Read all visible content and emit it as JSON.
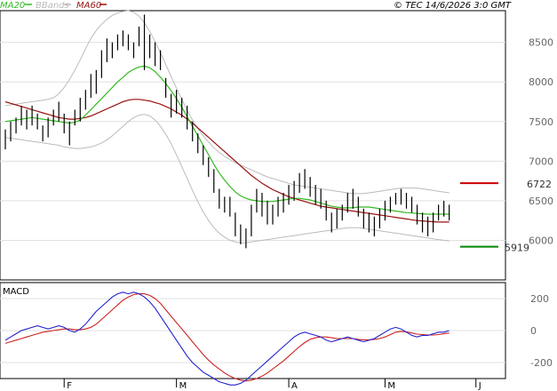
{
  "legend": {
    "ma20_label": "MA20",
    "bbands_label": "BBands",
    "ma60_label": "MA60"
  },
  "copyright": "© TEC 14/6/2026 3:0 GMT",
  "indicator_label": "MACD",
  "colors": {
    "ma20": "#33bb22",
    "bbands": "#bbbbbb",
    "ma60": "#991111",
    "macd": "#2222cc",
    "signal": "#cc2222",
    "price_bar": "#000000",
    "resistance": "#cc0000",
    "support": "#008800",
    "grid": "#e0e0e0"
  },
  "chart_data": {
    "type": "line",
    "price_panel": {
      "y_ticks": [
        6000,
        6500,
        7000,
        7500,
        8000,
        8500
      ],
      "y_tick_labels": [
        "6000",
        "6500",
        "7000",
        "7500",
        "8000",
        "8500"
      ],
      "ylim": [
        5500,
        8900
      ],
      "resistance": {
        "value": 6722,
        "label": "6722"
      },
      "support": {
        "value": 5919,
        "label": "5919"
      },
      "months": [
        {
          "label": "F",
          "index": 11
        },
        {
          "label": "M",
          "index": 32
        },
        {
          "label": "A",
          "index": 53
        },
        {
          "label": "M",
          "index": 71
        },
        {
          "label": "J",
          "index": 88
        }
      ],
      "bars": [
        [
          7400,
          7150
        ],
        [
          7500,
          7250
        ],
        [
          7550,
          7350
        ],
        [
          7700,
          7450
        ],
        [
          7650,
          7400
        ],
        [
          7700,
          7450
        ],
        [
          7600,
          7400
        ],
        [
          7450,
          7250
        ],
        [
          7550,
          7300
        ],
        [
          7650,
          7450
        ],
        [
          7750,
          7500
        ],
        [
          7600,
          7350
        ],
        [
          7500,
          7200
        ],
        [
          7650,
          7450
        ],
        [
          7800,
          7500
        ],
        [
          7900,
          7650
        ],
        [
          8100,
          7800
        ],
        [
          8150,
          7850
        ],
        [
          8400,
          8050
        ],
        [
          8550,
          8250
        ],
        [
          8500,
          8300
        ],
        [
          8600,
          8400
        ],
        [
          8650,
          8450
        ],
        [
          8600,
          8400
        ],
        [
          8500,
          8300
        ],
        [
          8700,
          8450
        ],
        [
          8850,
          8150
        ],
        [
          8600,
          8300
        ],
        [
          8500,
          8200
        ],
        [
          8400,
          8150
        ],
        [
          8050,
          7800
        ],
        [
          7850,
          7550
        ],
        [
          7900,
          7600
        ],
        [
          7800,
          7550
        ],
        [
          7700,
          7400
        ],
        [
          7500,
          7250
        ],
        [
          7350,
          7100
        ],
        [
          7200,
          6950
        ],
        [
          7050,
          6800
        ],
        [
          6900,
          6600
        ],
        [
          6650,
          6400
        ],
        [
          6550,
          6350
        ],
        [
          6550,
          6300
        ],
        [
          6350,
          6050
        ],
        [
          6200,
          5950
        ],
        [
          6150,
          5900
        ],
        [
          6450,
          6050
        ],
        [
          6650,
          6350
        ],
        [
          6600,
          6300
        ],
        [
          6500,
          6200
        ],
        [
          6450,
          6200
        ],
        [
          6550,
          6300
        ],
        [
          6600,
          6350
        ],
        [
          6700,
          6450
        ],
        [
          6750,
          6500
        ],
        [
          6850,
          6600
        ],
        [
          6900,
          6650
        ],
        [
          6800,
          6550
        ],
        [
          6700,
          6450
        ],
        [
          6650,
          6400
        ],
        [
          6500,
          6250
        ],
        [
          6350,
          6100
        ],
        [
          6400,
          6150
        ],
        [
          6450,
          6250
        ],
        [
          6600,
          6350
        ],
        [
          6650,
          6400
        ],
        [
          6550,
          6300
        ],
        [
          6400,
          6150
        ],
        [
          6350,
          6100
        ],
        [
          6300,
          6050
        ],
        [
          6400,
          6150
        ],
        [
          6500,
          6250
        ],
        [
          6550,
          6350
        ],
        [
          6600,
          6450
        ],
        [
          6650,
          6450
        ],
        [
          6600,
          6400
        ],
        [
          6550,
          6350
        ],
        [
          6450,
          6200
        ],
        [
          6350,
          6100
        ],
        [
          6300,
          6050
        ],
        [
          6350,
          6100
        ],
        [
          6450,
          6250
        ],
        [
          6500,
          6300
        ],
        [
          6450,
          6250
        ]
      ],
      "ma20": [
        7500,
        7510,
        7520,
        7530,
        7540,
        7550,
        7540,
        7530,
        7520,
        7510,
        7500,
        7490,
        7480,
        7490,
        7520,
        7580,
        7650,
        7720,
        7790,
        7860,
        7930,
        8000,
        8060,
        8120,
        8160,
        8190,
        8200,
        8180,
        8130,
        8060,
        7980,
        7890,
        7790,
        7680,
        7560,
        7440,
        7320,
        7200,
        7080,
        6960,
        6850,
        6760,
        6680,
        6610,
        6560,
        6530,
        6510,
        6500,
        6490,
        6490,
        6490,
        6500,
        6510,
        6520,
        6530,
        6530,
        6520,
        6510,
        6490,
        6470,
        6450,
        6430,
        6420,
        6410,
        6410,
        6410,
        6420,
        6420,
        6420,
        6410,
        6400,
        6390,
        6380,
        6370,
        6360,
        6350,
        6345,
        6340,
        6335,
        6330,
        6330,
        6330,
        6330,
        6330
      ],
      "ma60": [
        7750,
        7730,
        7710,
        7690,
        7670,
        7650,
        7630,
        7610,
        7590,
        7570,
        7550,
        7540,
        7530,
        7530,
        7540,
        7550,
        7570,
        7600,
        7630,
        7660,
        7690,
        7720,
        7750,
        7770,
        7780,
        7780,
        7770,
        7760,
        7740,
        7720,
        7690,
        7660,
        7620,
        7580,
        7530,
        7480,
        7420,
        7360,
        7300,
        7240,
        7180,
        7120,
        7060,
        7000,
        6940,
        6880,
        6820,
        6770,
        6720,
        6680,
        6640,
        6610,
        6580,
        6550,
        6530,
        6510,
        6490,
        6470,
        6450,
        6430,
        6420,
        6410,
        6400,
        6390,
        6380,
        6370,
        6360,
        6350,
        6340,
        6330,
        6320,
        6310,
        6300,
        6290,
        6280,
        6270,
        6260,
        6250,
        6245,
        6240,
        6235,
        6230,
        6230,
        6230
      ],
      "bb_upper": [
        7700,
        7710,
        7720,
        7730,
        7740,
        7750,
        7760,
        7770,
        7780,
        7800,
        7850,
        7930,
        8030,
        8150,
        8280,
        8420,
        8550,
        8650,
        8730,
        8790,
        8840,
        8870,
        8890,
        8900,
        8880,
        8830,
        8750,
        8640,
        8510,
        8370,
        8220,
        8070,
        7920,
        7780,
        7640,
        7520,
        7410,
        7320,
        7240,
        7170,
        7110,
        7060,
        7020,
        6980,
        6950,
        6920,
        6890,
        6860,
        6830,
        6800,
        6780,
        6760,
        6740,
        6720,
        6700,
        6690,
        6680,
        6670,
        6660,
        6650,
        6640,
        6630,
        6620,
        6610,
        6600,
        6590,
        6590,
        6590,
        6600,
        6610,
        6620,
        6630,
        6640,
        6650,
        6660,
        6660,
        6660,
        6660,
        6650,
        6640,
        6630,
        6620,
        6610,
        6600
      ],
      "bb_lower": [
        7300,
        7290,
        7280,
        7270,
        7260,
        7250,
        7240,
        7230,
        7220,
        7210,
        7200,
        7180,
        7170,
        7160,
        7160,
        7170,
        7180,
        7200,
        7230,
        7270,
        7320,
        7380,
        7440,
        7500,
        7550,
        7580,
        7590,
        7570,
        7520,
        7440,
        7340,
        7220,
        7080,
        6930,
        6780,
        6630,
        6490,
        6360,
        6250,
        6160,
        6090,
        6040,
        6000,
        5980,
        5970,
        5970,
        5980,
        5990,
        6000,
        6010,
        6020,
        6030,
        6040,
        6050,
        6060,
        6070,
        6080,
        6090,
        6100,
        6110,
        6120,
        6130,
        6140,
        6150,
        6160,
        6160,
        6160,
        6150,
        6140,
        6130,
        6120,
        6110,
        6100,
        6090,
        6080,
        6070,
        6060,
        6050,
        6040,
        6030,
        6020,
        6010,
        6000,
        5990
      ]
    },
    "macd_panel": {
      "y_ticks": [
        -200,
        0,
        200
      ],
      "y_tick_labels": [
        "-200",
        "0",
        "200"
      ],
      "ylim": [
        -300,
        300
      ],
      "macd": [
        -60,
        -40,
        -20,
        0,
        10,
        20,
        30,
        20,
        10,
        20,
        30,
        20,
        0,
        -10,
        10,
        40,
        80,
        120,
        150,
        180,
        210,
        230,
        240,
        230,
        240,
        230,
        210,
        180,
        140,
        90,
        40,
        -10,
        -60,
        -110,
        -160,
        -200,
        -230,
        -260,
        -280,
        -300,
        -320,
        -330,
        -340,
        -340,
        -330,
        -310,
        -280,
        -250,
        -220,
        -190,
        -160,
        -130,
        -100,
        -70,
        -40,
        -20,
        -10,
        -20,
        -30,
        -40,
        -60,
        -70,
        -60,
        -50,
        -40,
        -50,
        -60,
        -70,
        -60,
        -50,
        -30,
        -10,
        10,
        20,
        10,
        -10,
        -30,
        -40,
        -30,
        -30,
        -20,
        -10,
        -10,
        0
      ],
      "signal": [
        -80,
        -70,
        -60,
        -50,
        -40,
        -30,
        -20,
        -10,
        -5,
        0,
        5,
        10,
        10,
        5,
        5,
        10,
        20,
        40,
        70,
        100,
        130,
        160,
        190,
        210,
        225,
        230,
        230,
        220,
        200,
        170,
        130,
        90,
        50,
        10,
        -30,
        -70,
        -110,
        -150,
        -185,
        -215,
        -240,
        -265,
        -285,
        -300,
        -310,
        -315,
        -310,
        -300,
        -285,
        -265,
        -240,
        -215,
        -190,
        -160,
        -130,
        -100,
        -75,
        -55,
        -45,
        -40,
        -40,
        -45,
        -50,
        -50,
        -50,
        -50,
        -55,
        -58,
        -58,
        -55,
        -50,
        -40,
        -25,
        -10,
        -5,
        -8,
        -15,
        -22,
        -25,
        -28,
        -28,
        -25,
        -20,
        -15
      ]
    }
  }
}
